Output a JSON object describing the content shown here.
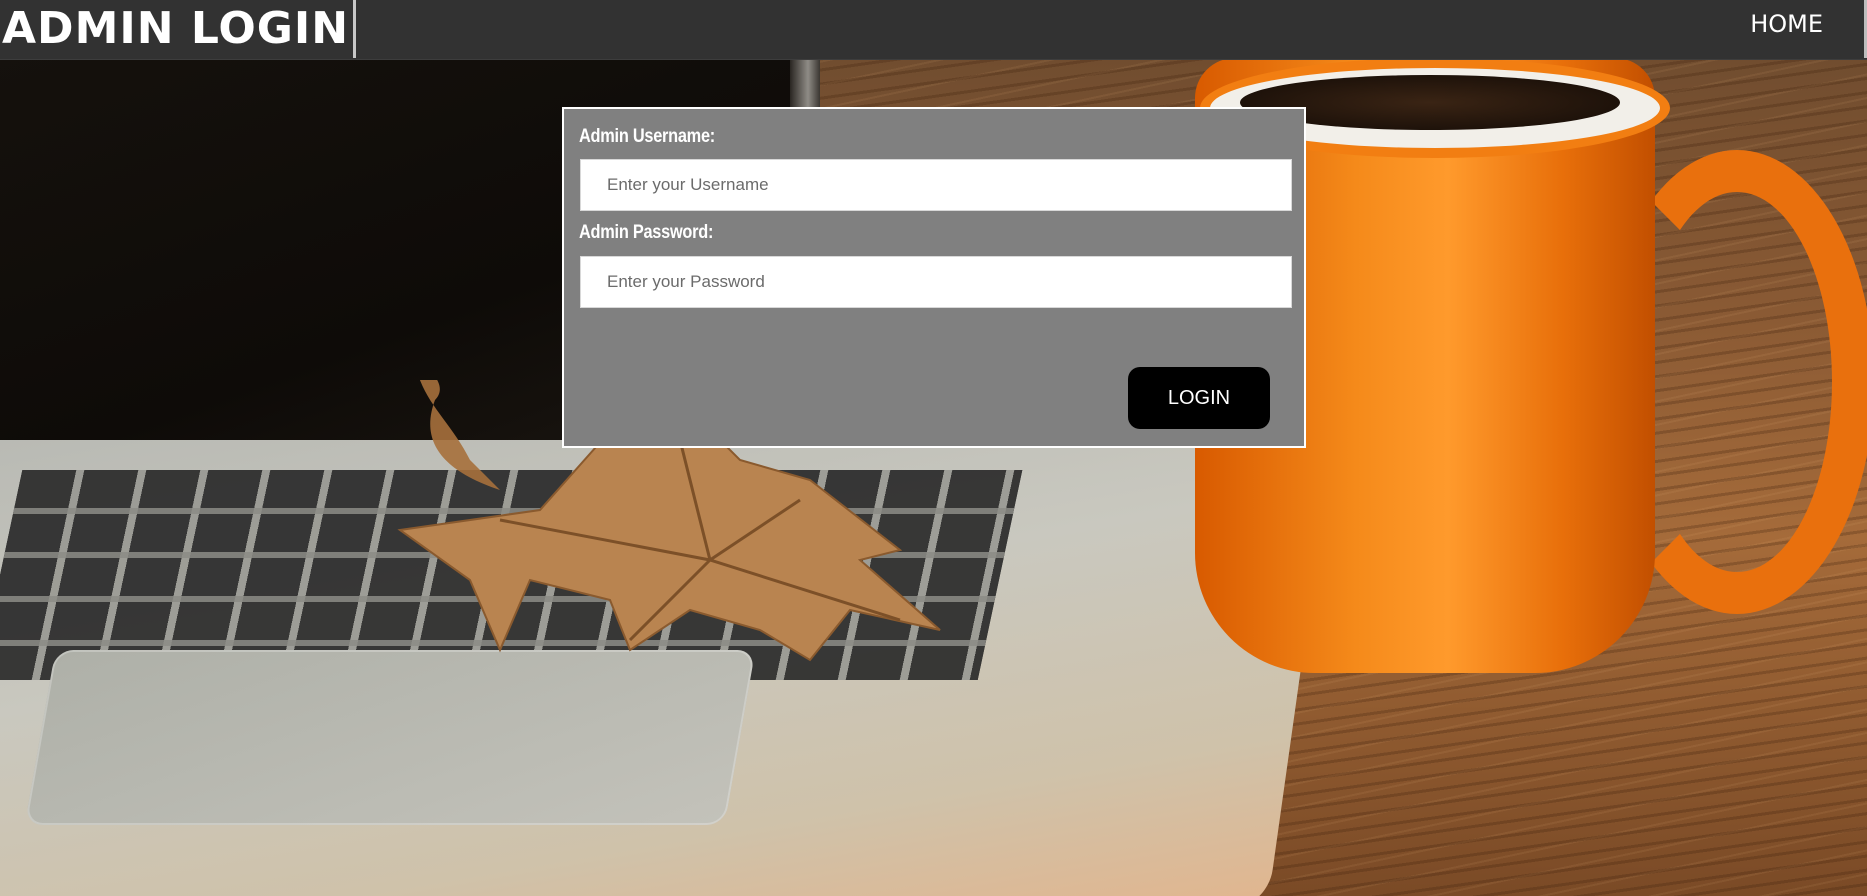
{
  "header": {
    "title": "ADMIN LOGIN",
    "nav_home": "HOME"
  },
  "login_form": {
    "username_label": "Admin Username:",
    "username_placeholder": "Enter your Username",
    "username_value": "",
    "password_label": "Admin Password:",
    "password_placeholder": "Enter your Password",
    "password_value": "",
    "submit_label": "LOGIN"
  },
  "colors": {
    "header_bg": "#323232",
    "panel_bg": "#808080",
    "button_bg": "#000000",
    "text": "#ffffff"
  },
  "background_image": "laptop-leaf-orange-mug-photo"
}
